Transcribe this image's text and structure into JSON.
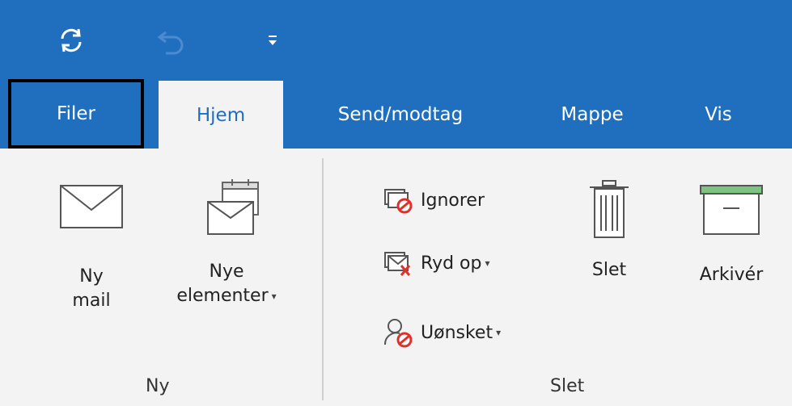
{
  "quick_access": {
    "sync_icon": "sync-icon",
    "undo_icon": "undo-icon",
    "customize_icon": "customize-quick-access-icon"
  },
  "tabs": [
    {
      "label": "Filer"
    },
    {
      "label": "Hjem"
    },
    {
      "label": "Send/modtag"
    },
    {
      "label": "Mappe"
    },
    {
      "label": "Vis"
    }
  ],
  "groups": {
    "ny": {
      "label": "Ny",
      "ny_mail": {
        "line1": "Ny",
        "line2": "mail"
      },
      "nye_elementer": {
        "line1": "Nye",
        "line2": "elementer"
      }
    },
    "slet": {
      "label": "Slet",
      "ignorer": "Ignorer",
      "ryd_op": "Ryd op",
      "uonsket": "Uønsket",
      "slet": "Slet",
      "arkiver": "Arkivér"
    }
  },
  "colors": {
    "accent": "#1f6fbe",
    "ribbon_bg": "#f3f3f3",
    "archive_green": "#7cc47f",
    "block_red": "#e0302a"
  }
}
